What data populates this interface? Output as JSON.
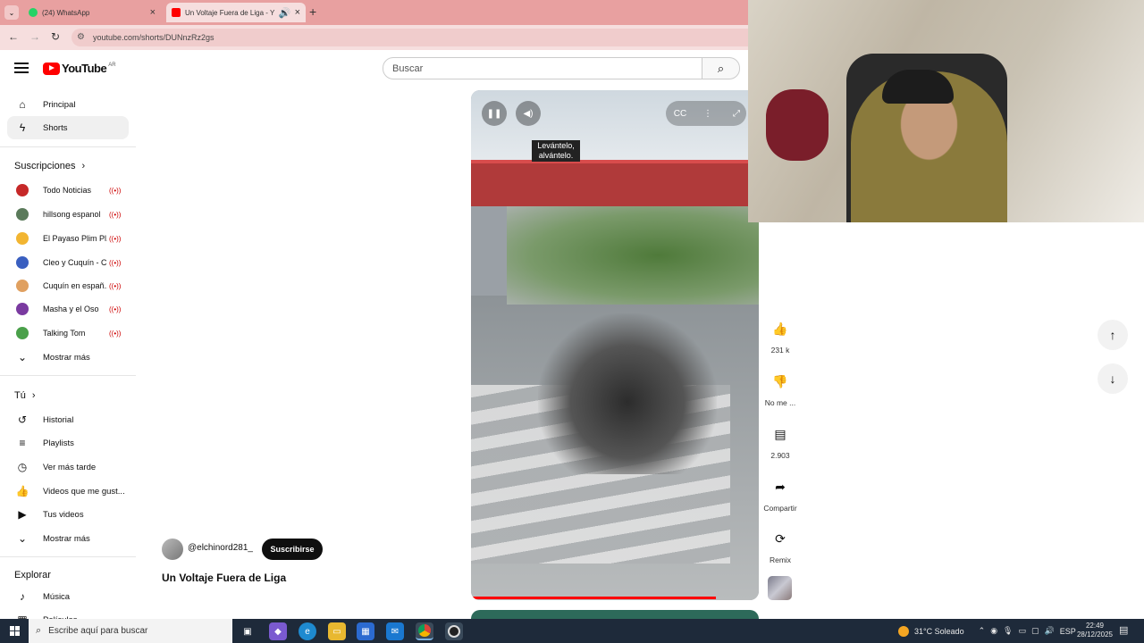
{
  "browser": {
    "tabs": [
      {
        "title": "(24) WhatsApp",
        "color": "#25d366"
      },
      {
        "title": "Un Voltaje Fuera de Liga - Y",
        "color": "#ff0000"
      }
    ],
    "url": "youtube.com/shorts/DUNnzRz2gs"
  },
  "header": {
    "logo": "YouTube",
    "country": "AR",
    "search_placeholder": "Buscar"
  },
  "sidebar": {
    "main": [
      {
        "label": "Principal",
        "icon": "home-icon"
      },
      {
        "label": "Shorts",
        "icon": "shorts-icon",
        "active": true
      }
    ],
    "subscriptions_title": "Suscripciones",
    "subscriptions": [
      {
        "label": "Todo Noticias",
        "color": "#c62828"
      },
      {
        "label": "hillsong espanol",
        "color": "#5a7a5a"
      },
      {
        "label": "El Payaso Plim Pl...",
        "color": "#f2b531"
      },
      {
        "label": "Cleo y Cuquín - C...",
        "color": "#3a5fc0"
      },
      {
        "label": "Cuquín en españ...",
        "color": "#e0a060"
      },
      {
        "label": "Masha y el Oso",
        "color": "#7a3aa0"
      },
      {
        "label": "Talking Tom",
        "color": "#4aa04a"
      }
    ],
    "subs_more": "Mostrar más",
    "you_title": "Tú",
    "you": [
      {
        "label": "Historial",
        "icon": "history-icon"
      },
      {
        "label": "Playlists",
        "icon": "playlist-icon"
      },
      {
        "label": "Ver más tarde",
        "icon": "clock-icon"
      },
      {
        "label": "Videos que me gust...",
        "icon": "like-icon"
      },
      {
        "label": "Tus videos",
        "icon": "video-icon"
      }
    ],
    "you_more": "Mostrar más",
    "explore_title": "Explorar",
    "explore": [
      {
        "label": "Música",
        "icon": "music-icon"
      },
      {
        "label": "Películas",
        "icon": "film-icon"
      }
    ]
  },
  "video": {
    "caption_line1": "Levántelo,",
    "caption_line2": "alvántelo.",
    "progress": 0.85,
    "channel": "@elchinord281_",
    "subscribe": "Suscribirse",
    "title": "Un Voltaje Fuera de Liga"
  },
  "actions": {
    "likes": "231 k",
    "dislike": "No me ...",
    "comments": "2.903",
    "share": "Compartir",
    "remix": "Remix"
  },
  "taskbar": {
    "search_placeholder": "Escribe aquí para buscar",
    "weather": "31°C Soleado",
    "lang": "ESP",
    "time": "22:49",
    "date": "28/12/2025"
  }
}
